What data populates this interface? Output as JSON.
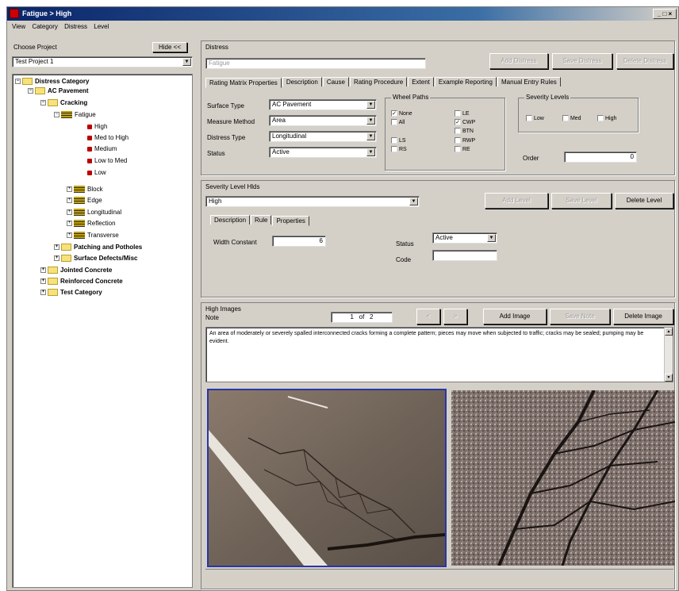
{
  "window": {
    "title": "Fatigue > High",
    "controls": "_ □ ×"
  },
  "menu": [
    "View",
    "Category",
    "Distress",
    "Level"
  ],
  "project": {
    "label": "Choose Project",
    "hide_label": "Hide <<",
    "value": "Test Project 1"
  },
  "tree": {
    "root": "Distress Category",
    "ac_pavement": "AC Pavement",
    "cracking": "Cracking",
    "fatigue": "Fatigue",
    "levels": [
      "High",
      "Med to High",
      "Medium",
      "Low to Med",
      "Low"
    ],
    "crack_types": [
      "Block",
      "Edge",
      "Longitudinal",
      "Reflection",
      "Transverse"
    ],
    "patching": "Patching and Potholes",
    "surface": "Surface Defects/Misc",
    "jointed": "Jointed Concrete",
    "reinforced": "Reinforced Concrete",
    "test": "Test Category"
  },
  "distress": {
    "label": "Distress",
    "value": "Fatigue",
    "buttons": [
      "Add Distress",
      "Save Distress",
      "Delete Distress"
    ],
    "tabs": [
      "Rating Matrix Properties",
      "Description",
      "Cause",
      "Rating Procedure",
      "Extent",
      "Example Reporting",
      "Manual Entry Rules"
    ],
    "surface_type": {
      "label": "Surface Type",
      "value": "AC Pavement"
    },
    "measure_method": {
      "label": "Measure Method",
      "value": "Area"
    },
    "distress_type": {
      "label": "Distress Type",
      "value": "Longitudinal"
    },
    "status": {
      "label": "Status",
      "value": "Active"
    },
    "wheel_paths": {
      "label": "Wheel Paths",
      "col1": [
        {
          "label": "None",
          "checked": true
        },
        {
          "label": "All",
          "checked": false
        },
        {
          "label": "LS",
          "checked": false
        },
        {
          "label": "RS",
          "checked": false
        }
      ],
      "col2": [
        {
          "label": "LE",
          "checked": false
        },
        {
          "label": "CWP",
          "checked": true
        },
        {
          "label": "BTN",
          "checked": false
        },
        {
          "label": "RWP",
          "checked": false
        },
        {
          "label": "RE",
          "checked": false
        }
      ]
    },
    "severity_levels": {
      "label": "Severity Levels",
      "options": [
        "Low",
        "Med",
        "High"
      ]
    },
    "order": {
      "label": "Order",
      "value": "0"
    }
  },
  "severity": {
    "label": "Severity Level Hlds",
    "value": "High",
    "buttons": [
      "Add Level",
      "Save Level",
      "Delete Level"
    ],
    "tabs": [
      "Description",
      "Rule",
      "Properties"
    ],
    "width_constant": {
      "label": "Width Constant",
      "value": "6"
    },
    "status": {
      "label": "Status",
      "value": "Active"
    },
    "code": {
      "label": "Code",
      "value": ""
    }
  },
  "images": {
    "label": "High Images",
    "note_label": "Note",
    "counter": [
      "1",
      "of",
      "2"
    ],
    "nav": [
      "<",
      ">"
    ],
    "buttons": [
      "Add Image",
      "Save Note",
      "Delete Image"
    ],
    "description": "An area of moderately or severely spalled interconnected cracks forming a complete pattern; pieces may move when subjected to traffic; cracks may be sealed; pumping may be evident."
  },
  "colors": {
    "title_start": "#0a246a",
    "title_end": "#3a6ea5",
    "face": "#d4d0c8",
    "selection_border": "#2a35a8"
  }
}
